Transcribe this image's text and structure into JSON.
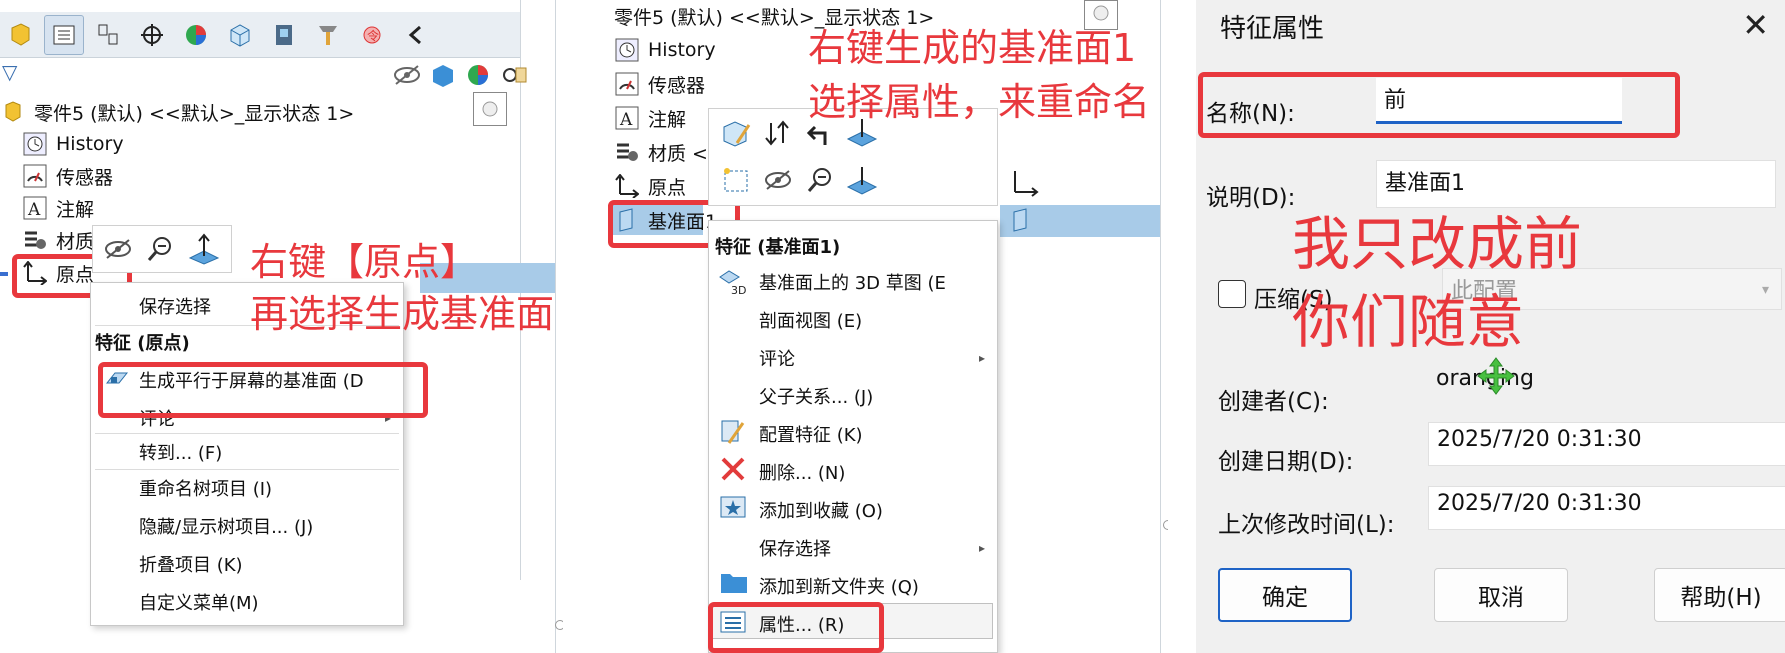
{
  "panel1": {
    "tree": {
      "root": "零件5 (默认) <<默认>_显示状态 1>",
      "items": [
        "History",
        "传感器",
        "注解",
        "材质",
        "原点"
      ]
    },
    "context_menu": {
      "save_selection": "保存选择",
      "section_header": "特征 (原点)",
      "items": [
        "生成平行于屏幕的基准面 (D",
        "评论",
        "转到... (F)",
        "重命名树项目 (I)",
        "隐藏/显示树项目... (J)",
        "折叠项目 (K)",
        "自定义菜单(M)"
      ]
    },
    "annotation": [
      "右键【原点】",
      "再选择生成基准面"
    ]
  },
  "panel2": {
    "tree": {
      "root": "零件5 (默认) <<默认>_显示状态 1>",
      "items": [
        "History",
        "传感器",
        "注解",
        "材质 <",
        "原点",
        "基准面1"
      ]
    },
    "context_menu": {
      "section_header": "特征 (基准面1)",
      "items": [
        "基准面上的 3D 草图 (E",
        "剖面视图 (E)",
        "评论",
        "父子关系... (J)",
        "配置特征 (K)",
        "删除... (N)",
        "添加到收藏 (O)",
        "保存选择",
        "添加到新文件夹 (Q)",
        "属性... (R)"
      ]
    },
    "annotation": [
      "右键生成的基准面1",
      "选择属性，来重命名"
    ]
  },
  "dialog": {
    "title": "特征属性",
    "name_label": "名称(N):",
    "name_value": "前",
    "desc_label": "说明(D):",
    "desc_value": "基准面1",
    "suppress_label": "压缩(S)",
    "config_value": "此配置",
    "creator_label": "创建者(C):",
    "creator_value": "oranging",
    "created_label": "创建日期(D):",
    "created_value": "2025/7/20 0:31:30",
    "modified_label": "上次修改时间(L):",
    "modified_value": "2025/7/20 0:31:30",
    "ok": "确定",
    "cancel": "取消",
    "help": "帮助(H)",
    "annotation": [
      "我只改成前",
      "你们随意"
    ]
  },
  "colors": {
    "annotation_red": "#e8383d",
    "selection_blue": "#a8cbe8",
    "focus_underline": "#1f63c6"
  }
}
